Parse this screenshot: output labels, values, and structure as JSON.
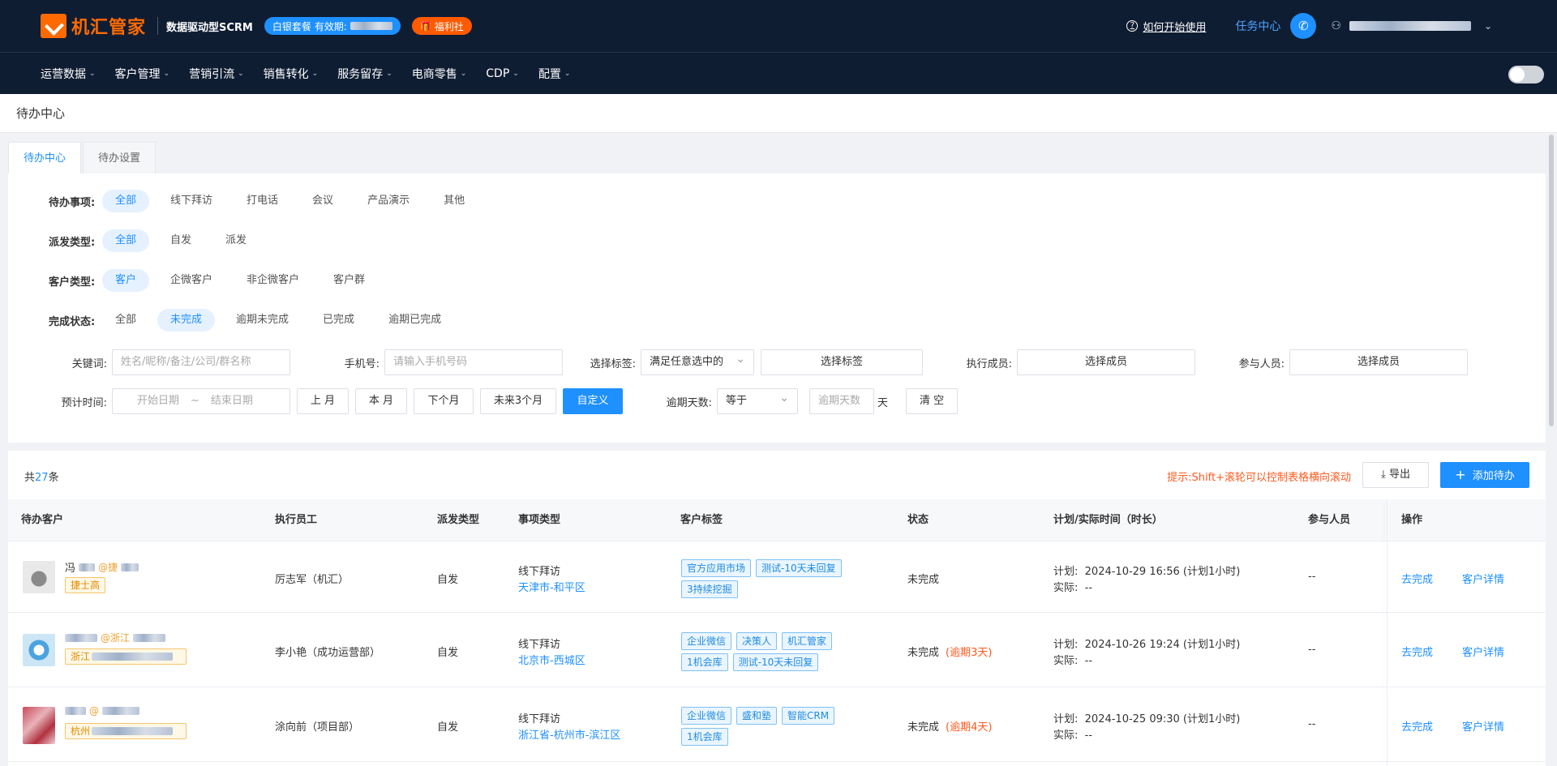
{
  "header": {
    "logo_text": "机汇管家",
    "slogan": "数据驱动型SCRM",
    "package_label": "白银套餐  有效期:",
    "welfare_label": "福利社",
    "help_label": "如何开始使用",
    "task_center": "任务中心"
  },
  "nav": {
    "items": [
      "运营数据",
      "客户管理",
      "营销引流",
      "销售转化",
      "服务留存",
      "电商零售",
      "CDP",
      "配置"
    ]
  },
  "page": {
    "title": "待办中心",
    "tabs": [
      "待办中心",
      "待办设置"
    ]
  },
  "filters": {
    "todo_label": "待办事项:",
    "todo_options": [
      "全部",
      "线下拜访",
      "打电话",
      "会议",
      "产品演示",
      "其他"
    ],
    "dispatch_label": "派发类型:",
    "dispatch_options": [
      "全部",
      "自发",
      "派发"
    ],
    "customer_label": "客户类型:",
    "customer_options": [
      "客户",
      "企微客户",
      "非企微客户",
      "客户群"
    ],
    "status_label": "完成状态:",
    "status_options": [
      "全部",
      "未完成",
      "逾期未完成",
      "已完成",
      "逾期已完成"
    ],
    "keyword_label": "关键词:",
    "keyword_placeholder": "姓名/昵称/备注/公司/群名称",
    "phone_label": "手机号:",
    "phone_placeholder": "请输入手机号码",
    "tag_label": "选择标签:",
    "tag_mode": "满足任意选中的",
    "tag_button": "选择标签",
    "executor_label": "执行成员:",
    "executor_button": "选择成员",
    "participant_label": "参与人员:",
    "participant_button": "选择成员",
    "time_label": "预计时间:",
    "start_placeholder": "开始日期",
    "date_sep": "~",
    "end_placeholder": "结束日期",
    "quick_buttons": [
      "上 月",
      "本 月",
      "下个月",
      "未来3个月",
      "自定义"
    ],
    "overdue_label": "逾期天数:",
    "overdue_op": "等于",
    "overdue_placeholder": "逾期天数",
    "overdue_unit": "天",
    "clear_button": "清 空"
  },
  "list": {
    "total_prefix": "共",
    "total_count": "27",
    "total_suffix": "条",
    "tip": "提示:Shift+滚轮可以控制表格横向滚动",
    "export_label": "导出",
    "add_label": "添加待办",
    "columns": [
      "待办客户",
      "执行员工",
      "派发类型",
      "事项类型",
      "客户标签",
      "状态",
      "计划/实际时间（时长）",
      "参与人员",
      "操作"
    ],
    "rows": [
      {
        "customer_name": "冯",
        "customer_corp": "@捷",
        "customer_tag": "捷士高",
        "executor": "厉志军（机汇）",
        "dispatch": "自发",
        "item_type": "线下拜访",
        "location": "天津市-和平区",
        "tags": [
          "官方应用市场",
          "测试-10天未回复",
          "3持续挖掘"
        ],
        "status": "未完成",
        "overdue": "",
        "plan_label": "计划:",
        "plan_time": "2024-10-29 16:56   (计划1小时)",
        "actual_label": "实际:",
        "actual_time": "--",
        "participants": "--",
        "op_complete": "去完成",
        "op_detail": "客户详情"
      },
      {
        "customer_name": "",
        "customer_corp": "@浙江",
        "customer_tag": "浙江",
        "executor": "李小艳（成功运营部）",
        "dispatch": "自发",
        "item_type": "线下拜访",
        "location": "北京市-西城区",
        "tags": [
          "企业微信",
          "决策人",
          "机汇管家",
          "1机会库",
          "测试-10天未回复"
        ],
        "status": "未完成",
        "overdue": "(逾期3天)",
        "plan_label": "计划:",
        "plan_time": "2024-10-26 19:24   (计划1小时)",
        "actual_label": "实际:",
        "actual_time": "--",
        "participants": "--",
        "op_complete": "去完成",
        "op_detail": "客户详情"
      },
      {
        "customer_name": "",
        "customer_corp": "@",
        "customer_tag": "杭州",
        "executor": "涂向前（项目部）",
        "dispatch": "自发",
        "item_type": "线下拜访",
        "location": "浙江省-杭州市-滨江区",
        "tags": [
          "企业微信",
          "盛和塾",
          "智能CRM",
          "1机会库"
        ],
        "status": "未完成",
        "overdue": "(逾期4天)",
        "plan_label": "计划:",
        "plan_time": "2024-10-25 09:30   (计划1小时)",
        "actual_label": "实际:",
        "actual_time": "--",
        "participants": "--",
        "op_complete": "去完成",
        "op_detail": "客户详情"
      }
    ]
  }
}
